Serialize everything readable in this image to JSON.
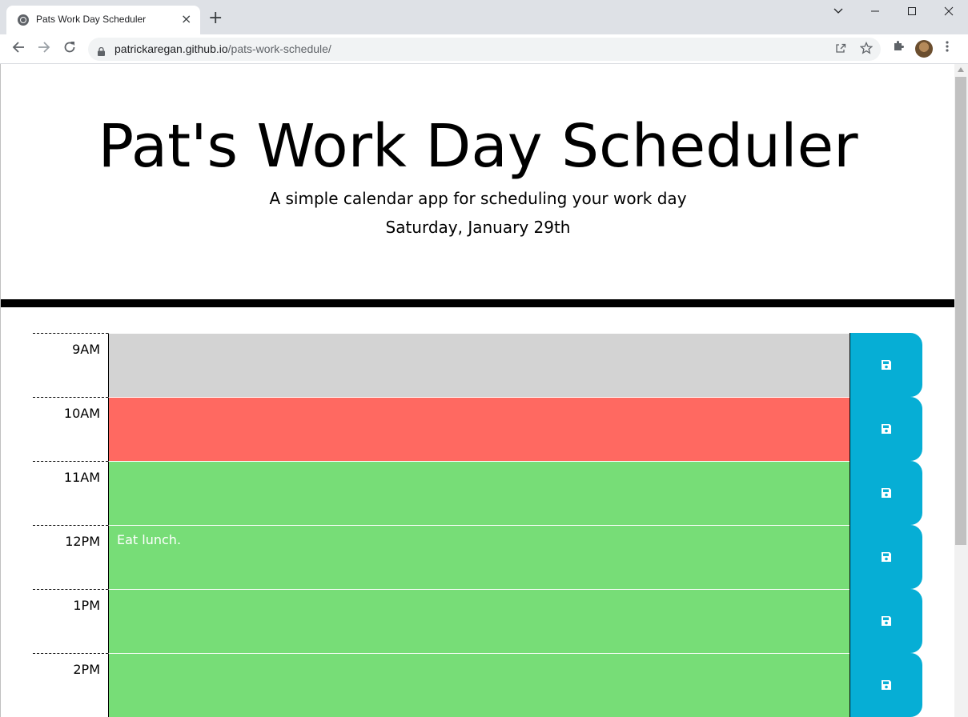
{
  "browser": {
    "tab_title": "Pats Work Day Scheduler",
    "tab_close": "×",
    "new_tab": "+",
    "url_host": "patrickaregan.github.io",
    "url_path": "/pats-work-schedule/",
    "icons": [
      "globe-icon",
      "back-icon",
      "forward-icon",
      "reload-icon",
      "lock-icon",
      "share-icon",
      "star-icon",
      "extensions-icon",
      "avatar",
      "menu-icon",
      "minimize-icon",
      "maximize-icon",
      "close-icon",
      "tab-search-icon"
    ]
  },
  "header": {
    "title": "Pat's Work Day Scheduler",
    "subtitle": "A simple calendar app for scheduling your work day",
    "current_day": "Saturday, January 29th"
  },
  "colors": {
    "past": "#d3d3d3",
    "present": "#ff6961",
    "future": "#77dd77",
    "save_button": "#06aed5"
  },
  "schedule": {
    "rows": [
      {
        "hour": "9AM",
        "text": "",
        "state": "past"
      },
      {
        "hour": "10AM",
        "text": "",
        "state": "present"
      },
      {
        "hour": "11AM",
        "text": "",
        "state": "future"
      },
      {
        "hour": "12PM",
        "text": "Eat lunch.",
        "state": "future"
      },
      {
        "hour": "1PM",
        "text": "",
        "state": "future"
      },
      {
        "hour": "2PM",
        "text": "",
        "state": "future"
      }
    ]
  }
}
